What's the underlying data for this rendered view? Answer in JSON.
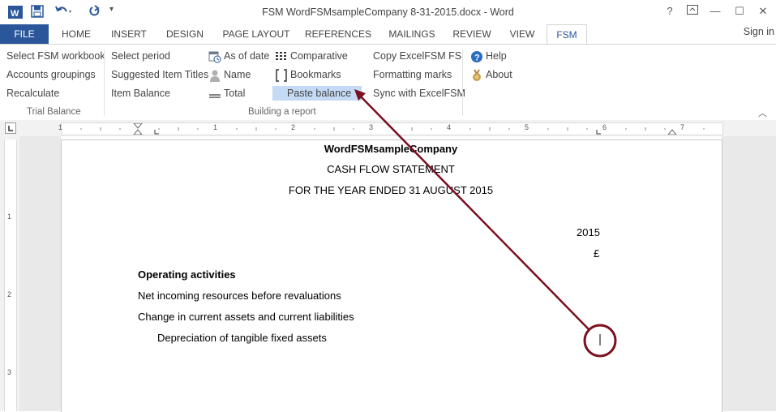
{
  "window": {
    "title": "FSM WordFSMsampleCompany 8-31-2015.docx - Word",
    "help": "?",
    "minimize": "—",
    "maximize": "☐",
    "close": "✕"
  },
  "tabs": [
    "FILE",
    "HOME",
    "INSERT",
    "DESIGN",
    "PAGE LAYOUT",
    "REFERENCES",
    "MAILINGS",
    "REVIEW",
    "VIEW",
    "FSM"
  ],
  "active_tab": "FSM",
  "signin": "Sign in",
  "ribbon": {
    "trial_balance": {
      "label": "Trial Balance",
      "items": [
        "Select FSM workbook",
        "Accounts groupings",
        "Recalculate"
      ]
    },
    "building": {
      "label": "Building a report",
      "col1": [
        "Select period",
        "Suggested Item Titles",
        "Item Balance"
      ],
      "col2": [
        "As of date",
        "Name",
        "Total"
      ],
      "col3": [
        "Comparative",
        "Bookmarks",
        "Paste balance"
      ],
      "col4": [
        "Copy ExcelFSM FS",
        "Formatting marks",
        "Sync with ExcelFSM"
      ]
    },
    "help": {
      "items": [
        "Help",
        "About"
      ]
    }
  },
  "ruler": {
    "h_numbers": [
      "1",
      "1",
      "2",
      "3",
      "4",
      "5",
      "6",
      "7"
    ],
    "v_numbers": [
      "1",
      "2",
      "3"
    ]
  },
  "document": {
    "company": "WordFSMsampleCompany",
    "statement": "CASH FLOW STATEMENT",
    "period": "FOR THE YEAR ENDED 31 AUGUST 2015",
    "year": "2015",
    "currency": "£",
    "section": "Operating activities",
    "line1": "Net incoming resources before revaluations",
    "line2": "Change in current assets and current liabilities",
    "line3": "Depreciation of tangible fixed assets"
  },
  "colors": {
    "accent": "#2b579a",
    "annotation": "#7a1020",
    "highlight": "#c5daf5"
  }
}
